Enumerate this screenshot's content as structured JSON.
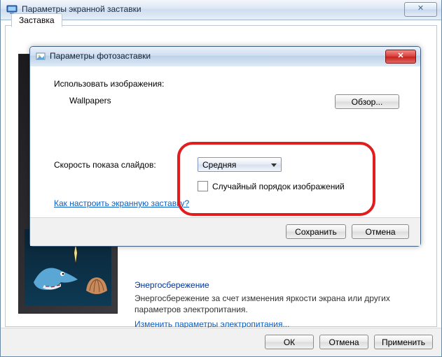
{
  "outer": {
    "title": "Параметры экранной заставки",
    "tab_label": "Заставка",
    "close_glyph": "✕",
    "energy_title": "Энергосбережение",
    "energy_text": "Энергосбережение за счет изменения яркости экрана или других параметров электропитания.",
    "energy_link": "Изменить параметры электропитания...",
    "ok": "ОК",
    "cancel": "Отмена",
    "apply": "Применить"
  },
  "inner": {
    "title": "Параметры фотозаставки",
    "use_images_label": "Использовать изображения:",
    "folder_name": "Wallpapers",
    "browse": "Обзор...",
    "speed_label": "Скорость показа слайдов:",
    "speed_value": "Средняя",
    "shuffle_label": "Случайный порядок изображений",
    "help_link": "Как настроить экранную заставку?",
    "save": "Сохранить",
    "cancel": "Отмена"
  }
}
